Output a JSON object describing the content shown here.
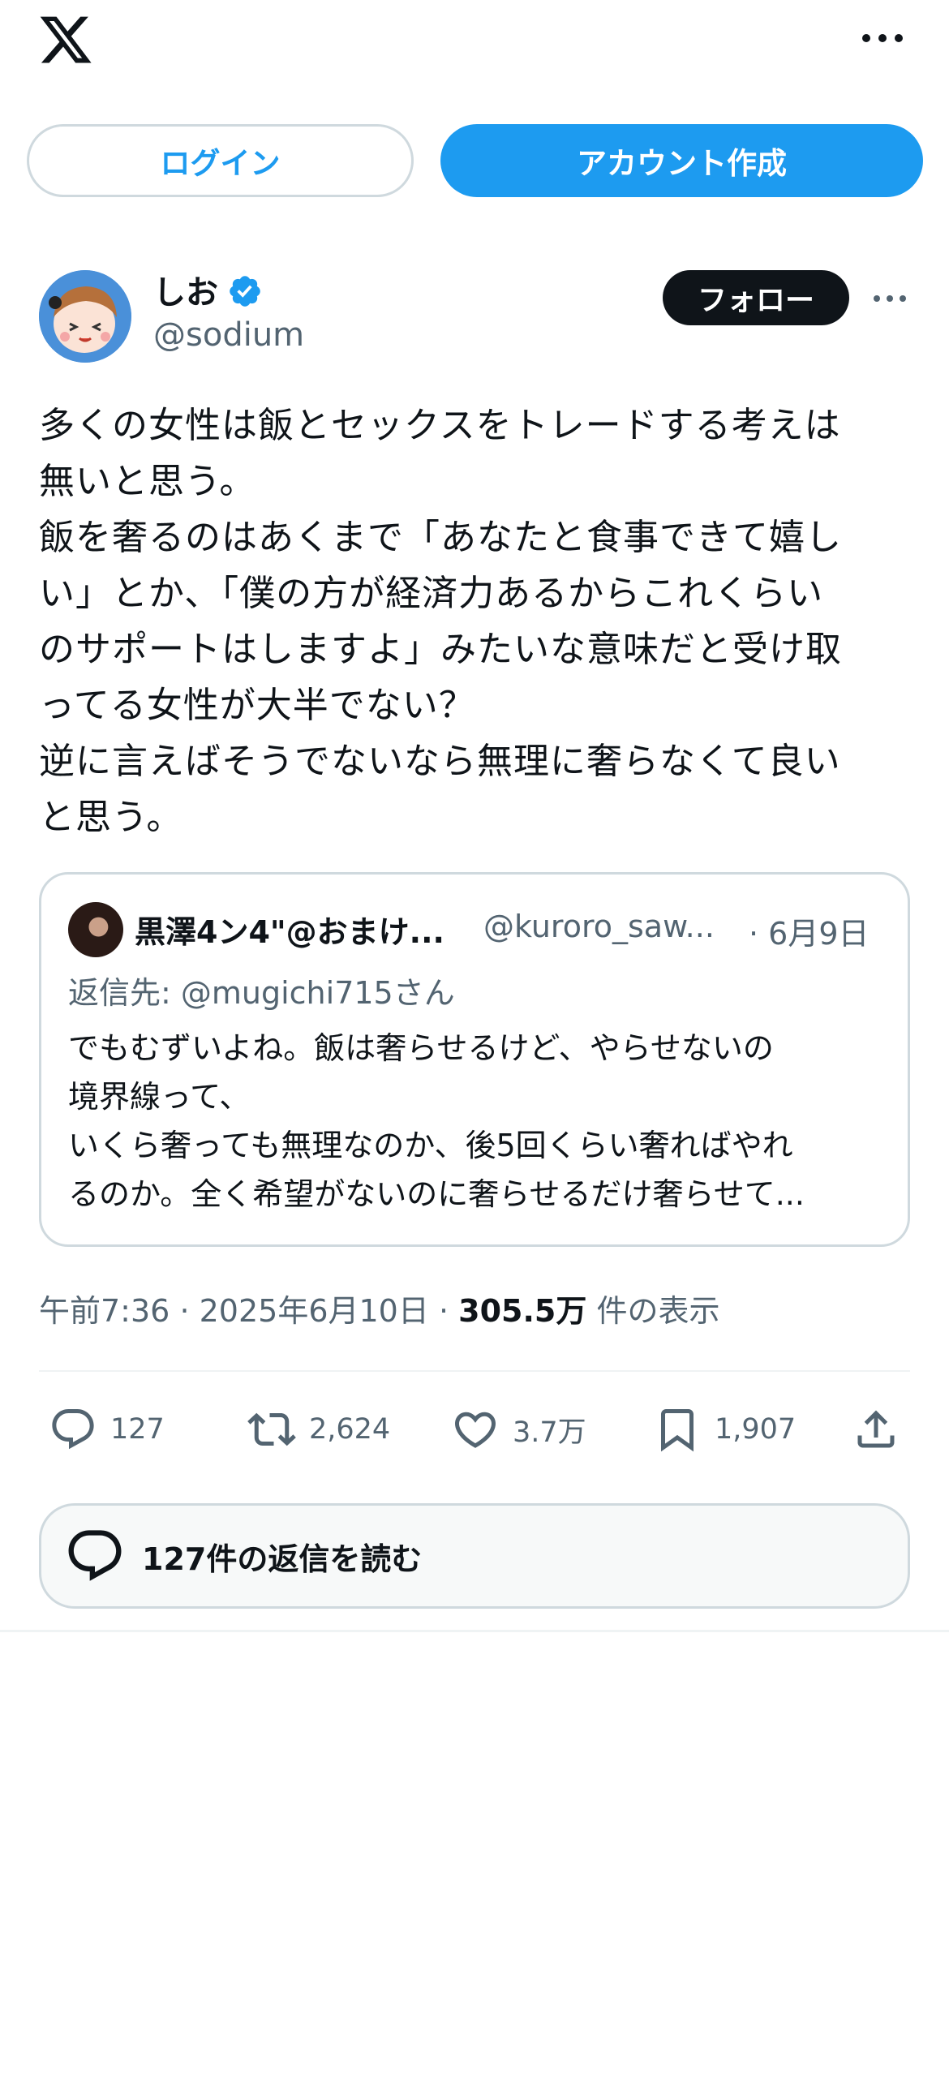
{
  "header": {
    "logo": "x-logo-icon",
    "login_label": "ログイン",
    "signup_label": "アカウント作成"
  },
  "post": {
    "author_name": "しお",
    "author_handle": "@sodium",
    "verified": true,
    "follow_label": "フォロー",
    "text": "多くの女性は飯とセックスをトレードする考えは\n無いと思う。\n飯を奢るのはあくまで「あなたと食事できて嬉し\nい」とか、「僕の方が経済力あるからこれくらい\nのサポートはしますよ」みたいな意味だと受け取\nってる女性が大半でない？\n逆に言えばそうでないなら無理に奢らなくて良い\nと思う。",
    "time": "午前7:36",
    "date": "2025年6月10日",
    "views_count": "305.5万",
    "views_label": "件の表示",
    "separator": "·"
  },
  "quote": {
    "author_name": "黒澤4ン4\"@おまけ...",
    "author_handle": "@kuroro_saw...",
    "date": "· 6月9日",
    "reply_to": "返信先: @mugichi715さん",
    "text": "でもむずいよね。飯は奢らせるけど、やらせないの\n境界線って、\nいくら奢っても無理なのか、後5回くらい奢ればやれ\nるのか。全く希望がないのに奢らせるだけ奢らせて..."
  },
  "actions": {
    "replies": "127",
    "reposts": "2,624",
    "likes": "3.7万",
    "bookmarks": "1,907"
  },
  "read_replies_label": "127件の返信を読む",
  "colors": {
    "accent": "#1d9bf0",
    "text": "#0f1419",
    "secondary": "#536471",
    "border": "#cfd9de"
  }
}
